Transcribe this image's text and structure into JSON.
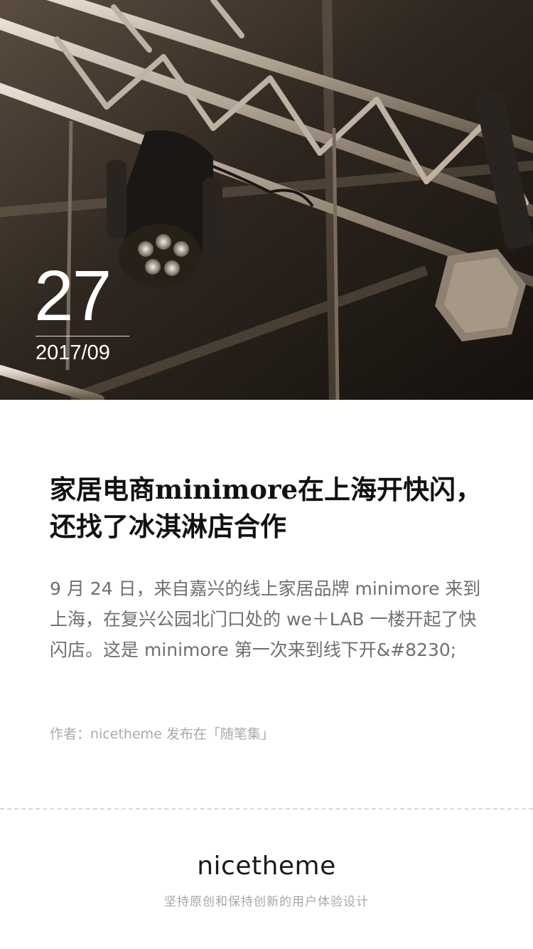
{
  "hero": {
    "day": "27",
    "month": "2017/09"
  },
  "article": {
    "title": "家居电商minimore在上海开快闪，还找了冰淇淋店合作",
    "excerpt": "9 月 24 日，来自嘉兴的线上家居品牌 minimore 来到上海，在复兴公园北门口处的 we＋LAB 一楼开起了快闪店。这是 minimore 第一次来到线下开&#8230;",
    "meta": "作者：nicetheme 发布在「随笔集」"
  },
  "footer": {
    "brand": "nicetheme",
    "tagline": "坚持原创和保持创新的用户体验设计"
  }
}
